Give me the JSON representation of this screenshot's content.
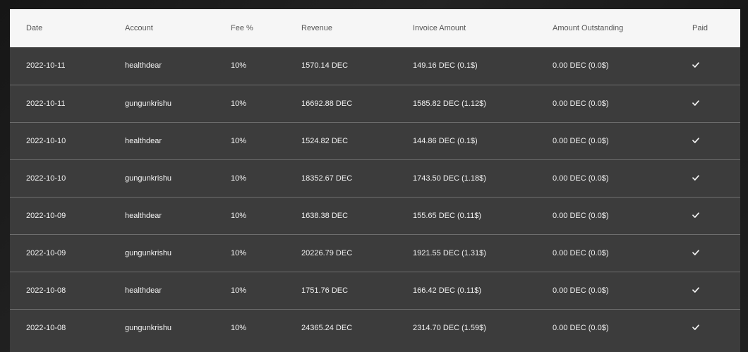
{
  "table": {
    "columns": [
      "Date",
      "Account",
      "Fee %",
      "Revenue",
      "Invoice Amount",
      "Amount Outstanding",
      "Paid"
    ],
    "rows": [
      {
        "date": "2022-10-11",
        "account": "healthdear",
        "fee": "10%",
        "revenue": "1570.14 DEC",
        "invoice": "149.16 DEC (0.1$)",
        "outstanding": "0.00 DEC (0.0$)",
        "paid": true
      },
      {
        "date": "2022-10-11",
        "account": "gungunkrishu",
        "fee": "10%",
        "revenue": "16692.88 DEC",
        "invoice": "1585.82 DEC (1.12$)",
        "outstanding": "0.00 DEC (0.0$)",
        "paid": true
      },
      {
        "date": "2022-10-10",
        "account": "healthdear",
        "fee": "10%",
        "revenue": "1524.82 DEC",
        "invoice": "144.86 DEC (0.1$)",
        "outstanding": "0.00 DEC (0.0$)",
        "paid": true
      },
      {
        "date": "2022-10-10",
        "account": "gungunkrishu",
        "fee": "10%",
        "revenue": "18352.67 DEC",
        "invoice": "1743.50 DEC (1.18$)",
        "outstanding": "0.00 DEC (0.0$)",
        "paid": true
      },
      {
        "date": "2022-10-09",
        "account": "healthdear",
        "fee": "10%",
        "revenue": "1638.38 DEC",
        "invoice": "155.65 DEC (0.11$)",
        "outstanding": "0.00 DEC (0.0$)",
        "paid": true
      },
      {
        "date": "2022-10-09",
        "account": "gungunkrishu",
        "fee": "10%",
        "revenue": "20226.79 DEC",
        "invoice": "1921.55 DEC (1.31$)",
        "outstanding": "0.00 DEC (0.0$)",
        "paid": true
      },
      {
        "date": "2022-10-08",
        "account": "healthdear",
        "fee": "10%",
        "revenue": "1751.76 DEC",
        "invoice": "166.42 DEC (0.11$)",
        "outstanding": "0.00 DEC (0.0$)",
        "paid": true
      },
      {
        "date": "2022-10-08",
        "account": "gungunkrishu",
        "fee": "10%",
        "revenue": "24365.24 DEC",
        "invoice": "2314.70 DEC (1.59$)",
        "outstanding": "0.00 DEC (0.0$)",
        "paid": true
      }
    ],
    "paid_icon": "check-icon",
    "colors": {
      "header_bg": "#f6f6f6",
      "row_bg": "#3c3c3c",
      "row_text": "#f2f2f2",
      "header_text": "#555555"
    }
  }
}
